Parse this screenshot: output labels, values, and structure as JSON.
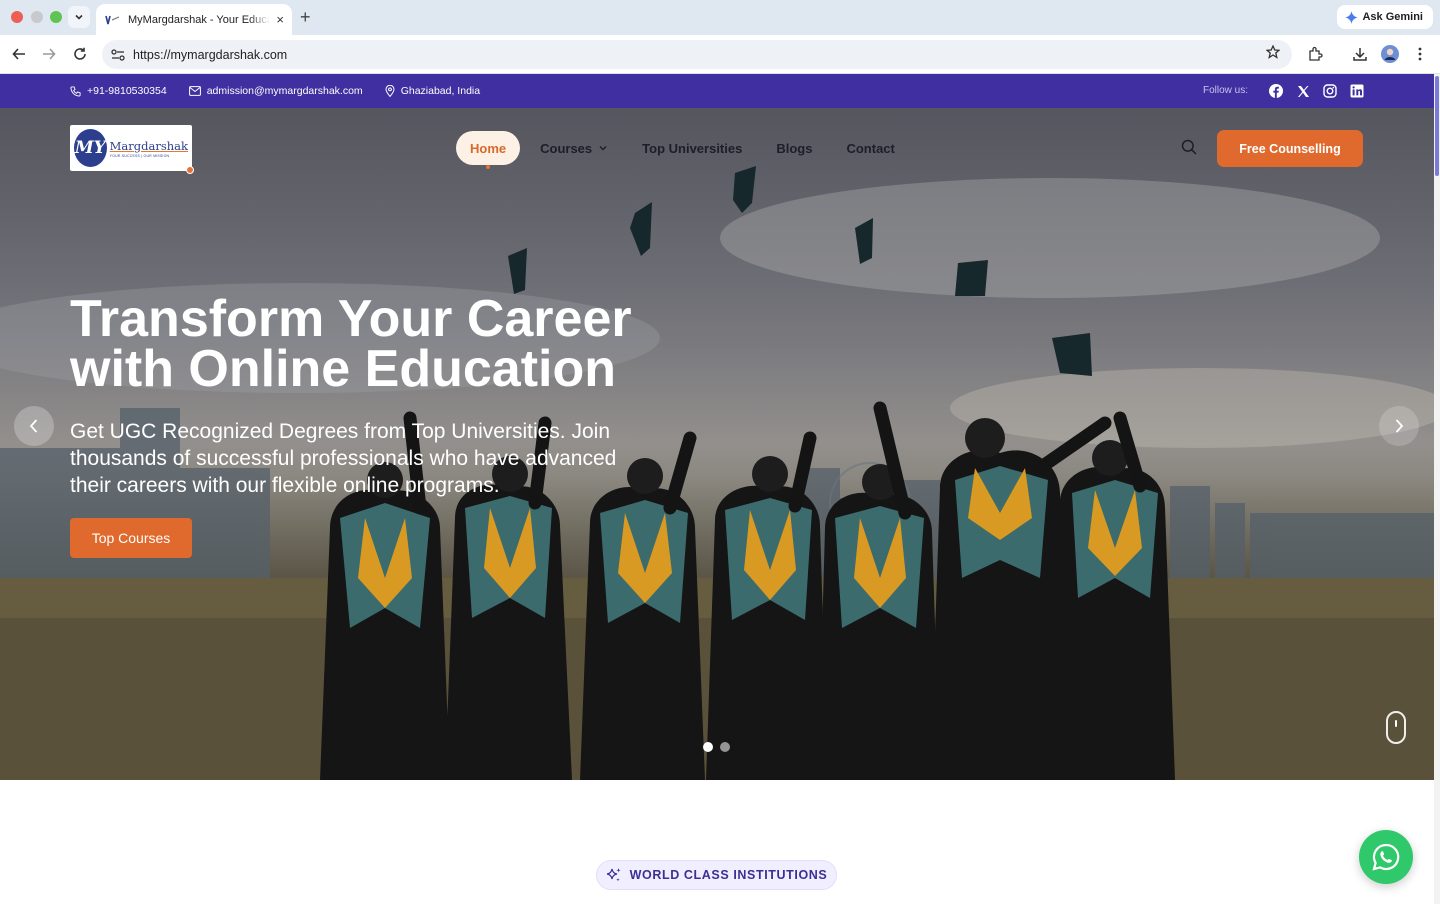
{
  "browser": {
    "tab_title": "MyMargdarshak - Your Education Partner",
    "new_tab_symbol": "+",
    "close_symbol": "×",
    "url": "https://mymargdarshak.com",
    "gemini_label": "Ask Gemini"
  },
  "topbar": {
    "phone": "+91-9810530354",
    "email": "admission@mymargdarshak.com",
    "location": "Ghaziabad, India",
    "follow_label": "Follow us:",
    "socials": [
      "facebook-icon",
      "x-icon",
      "instagram-icon",
      "linkedin-icon"
    ]
  },
  "logo": {
    "mark": "MY",
    "name": "Margdarshak",
    "tagline": "YOUR SUCCESS | OUR MISSION"
  },
  "nav": {
    "items": [
      {
        "label": "Home",
        "active": true
      },
      {
        "label": "Courses",
        "has_dropdown": true
      },
      {
        "label": "Top Universities"
      },
      {
        "label": "Blogs"
      },
      {
        "label": "Contact"
      }
    ],
    "cta": "Free Counselling"
  },
  "hero": {
    "title": "Transform Your Career with Online Education",
    "subtitle": "Get UGC Recognized Degrees from Top Universities. Join thousands of successful professionals who have advanced their careers with our flexible online programs.",
    "button": "Top Courses",
    "slide_count": 2,
    "active_slide": 1
  },
  "section": {
    "badge": "WORLD CLASS INSTITUTIONS"
  },
  "colors": {
    "topbar": "#3f2fa0",
    "accent_orange": "#e0692d",
    "badge_text": "#3b2f95",
    "whatsapp": "#2fc86a"
  }
}
